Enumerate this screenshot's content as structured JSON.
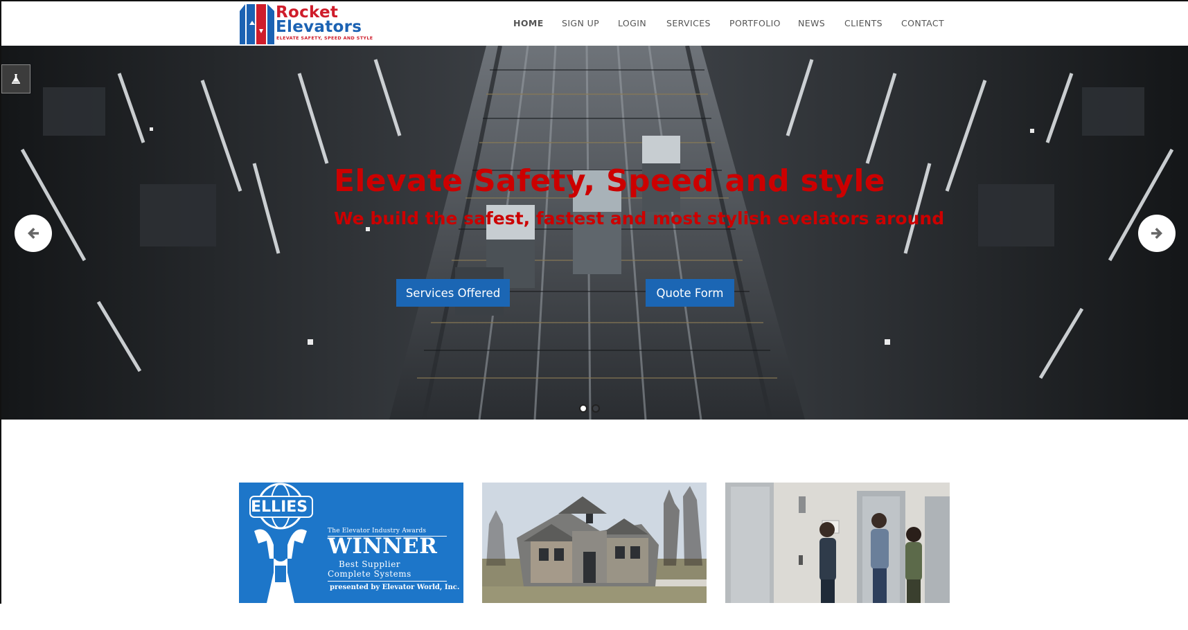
{
  "logo": {
    "brand_line1": "Rocket",
    "brand_line2": "Elevators",
    "tagline": "ELEVATE SAFETY, SPEED AND STYLE"
  },
  "nav": {
    "items": [
      {
        "label": "HOME",
        "active": true
      },
      {
        "label": "SIGN UP"
      },
      {
        "label": "LOGIN"
      },
      {
        "label": "SERVICES"
      },
      {
        "label": "PORTFOLIO"
      },
      {
        "label": "NEWS"
      },
      {
        "label": "CLIENTS"
      },
      {
        "label": "CONTACT"
      }
    ]
  },
  "hero": {
    "title": "Elevate Safety, Speed and style",
    "subtitle": "We build the safest, fastest and most stylish evelators around",
    "buttons": {
      "services": "Services Offered",
      "quote": "Quote Form"
    },
    "slide_count": 2,
    "active_slide": 1
  },
  "cards": {
    "award": {
      "badge": "ELLIES",
      "top_line": "The Elevator Industry Awards",
      "winner": "WINNER",
      "line1": "Best Supplier",
      "line2": "Complete Systems",
      "presented_by": "presented by Elevator World, Inc."
    }
  },
  "colors": {
    "accent_red": "#cc0000",
    "brand_blue": "#1b66b4",
    "nav_text": "#555555",
    "award_blue": "#1d76c9"
  },
  "icons": {
    "lab": "flask-icon",
    "prev": "arrow-left-icon",
    "next": "arrow-right-icon"
  }
}
